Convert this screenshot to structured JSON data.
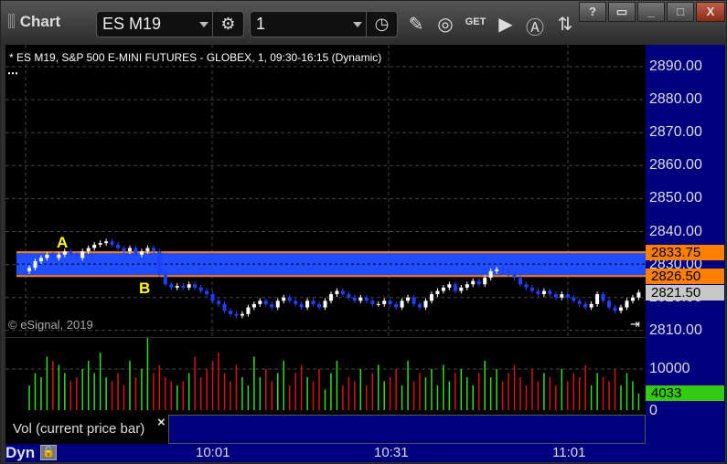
{
  "window": {
    "title": "Chart",
    "symbol": "ES M19",
    "interval": "1",
    "help": "?",
    "close": "X"
  },
  "chart": {
    "header": "* ES M19, S&P 500 E-MINI FUTURES - GLOBEX, 1, 09:30-16:15 (Dynamic)",
    "copyright": "© eSignal, 2019",
    "label_a": "A",
    "label_b": "B",
    "price_labels": [
      "2890.00",
      "2880.00",
      "2870.00",
      "2860.00",
      "2850.00",
      "2840.00",
      "2830.00",
      "2820.00",
      "2810.00"
    ],
    "tags": {
      "upper": "2833.75",
      "lower": "2826.50",
      "last": "2821.50"
    },
    "volume_labels": [
      "10000",
      "0"
    ],
    "volume_last": "4033",
    "volume_study": "Vol (current price bar)",
    "close_study": "×",
    "time_labels": [
      "10:01",
      "10:31",
      "11:01"
    ],
    "mode": "Dyn"
  },
  "colors": {
    "band": "#1f4dff",
    "band_line": "#ff8000",
    "up": "#ffffff",
    "down": "#2040ff",
    "vol_up": "#33dd22",
    "vol_down": "#dd1111"
  },
  "chart_data": {
    "type": "candlestick",
    "first_time": "09:30",
    "band": [
      2826.5,
      2833.75
    ],
    "ylim": [
      2810,
      2892
    ],
    "premarket": 2888,
    "closes": [
      2829,
      2831,
      2832,
      2833,
      2832,
      2833,
      2834,
      2833,
      2832,
      2834,
      2835,
      2836,
      2836.5,
      2837,
      2836,
      2835,
      2834,
      2835,
      2833,
      2834,
      2835,
      2834,
      2827,
      2824,
      2823,
      2823.5,
      2823,
      2824,
      2823,
      2822,
      2821,
      2819,
      2818,
      2816,
      2815,
      2814.5,
      2815,
      2817,
      2818,
      2819,
      2818,
      2817,
      2819,
      2820,
      2819,
      2818,
      2817,
      2819,
      2818,
      2817,
      2819,
      2821,
      2822,
      2821,
      2820,
      2819,
      2820,
      2819,
      2818,
      2818,
      2819,
      2818,
      2817,
      2819,
      2820,
      2818,
      2817,
      2819,
      2821,
      2822,
      2823,
      2824,
      2822,
      2823,
      2824,
      2825,
      2824,
      2826,
      2828,
      2828.5,
      2828,
      2827,
      2826,
      2824,
      2823,
      2822,
      2821,
      2822,
      2821,
      2820,
      2821,
      2820,
      2819,
      2818,
      2817,
      2818,
      2821,
      2819,
      2817,
      2816,
      2817,
      2819,
      2820,
      2821.5
    ],
    "volumes": [
      6000,
      9000,
      8000,
      13000,
      12000,
      11000,
      9000,
      7000,
      8000,
      10000,
      12000,
      9000,
      14000,
      8000,
      7000,
      9000,
      6000,
      12000,
      8000,
      10000,
      18000,
      9000,
      11000,
      8000,
      7000,
      6000,
      7000,
      9000,
      13000,
      8000,
      10000,
      12000,
      14000,
      9000,
      7000,
      11000,
      8000,
      6000,
      13000,
      8000,
      10000,
      7000,
      9000,
      12000,
      6000,
      9000,
      11000,
      8000,
      7000,
      10000,
      5000,
      9000,
      12000,
      6000,
      8000,
      7000,
      10000,
      6000,
      9000,
      11000,
      7000,
      8000,
      10000,
      6000,
      12000,
      7000,
      9000,
      8000,
      10000,
      6000,
      11000,
      7000,
      9000,
      10000,
      8000,
      6000,
      9000,
      12000,
      8000,
      10000,
      7000,
      9000,
      11000,
      8000,
      6000,
      10000,
      7000,
      9000,
      8000,
      6000,
      10000,
      7000,
      9000,
      8000,
      11000,
      6000,
      9000,
      8000,
      7000,
      10000,
      6000,
      9000,
      7000,
      4033
    ]
  }
}
